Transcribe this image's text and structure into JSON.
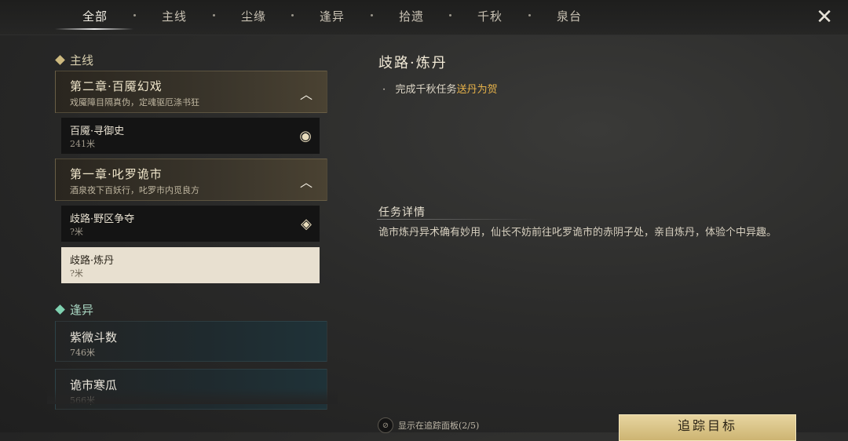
{
  "tabs": [
    {
      "label": "全部",
      "active": true
    },
    {
      "label": "主线"
    },
    {
      "label": "尘缘"
    },
    {
      "label": "逢异"
    },
    {
      "label": "拾遗"
    },
    {
      "label": "千秋"
    },
    {
      "label": "泉台"
    }
  ],
  "close_icon": "close-x-icon",
  "sections": {
    "main": {
      "label": "主线",
      "chapters": [
        {
          "title": "第二章·百魇幻戏",
          "subtitle": "戏魇障目隔真伪，定魂驱厄涤书狂",
          "expanded": true,
          "quests": [
            {
              "title": "百魇·寻御史",
              "distance": "241米",
              "icon": "eye-icon"
            }
          ]
        },
        {
          "title": "第一章·叱罗诡市",
          "subtitle": "酒泉夜下百妖行，叱罗市内觅良方",
          "expanded": true,
          "quests": [
            {
              "title": "歧路·野区争夺",
              "distance": "?米",
              "icon": "diamond-marker-icon"
            },
            {
              "title": "歧路·炼丹",
              "distance": "?米",
              "selected": true
            }
          ]
        }
      ]
    },
    "serendipity": {
      "label": "逢异",
      "items": [
        {
          "title": "紫微斗数",
          "distance": "746米"
        },
        {
          "title": "诡市寒瓜",
          "distance": "566米"
        }
      ]
    }
  },
  "detail": {
    "title": "歧路·炼丹",
    "objective_prefix": "完成千秋任务",
    "objective_highlight": "送丹为贺",
    "section_title": "任务详情",
    "description": "诡市炼丹异术确有妙用，仙长不妨前往叱罗诡市的赤阴子处，亲自炼丹，体验个中异趣。"
  },
  "footer": {
    "track_toggle_label": "显示在追踪面板(2/5)",
    "track_button_label": "追踪目标"
  },
  "colors": {
    "highlight": "#e6b24a",
    "selected_bg": "#e8e0d0",
    "button_gold": "#d9c283"
  }
}
